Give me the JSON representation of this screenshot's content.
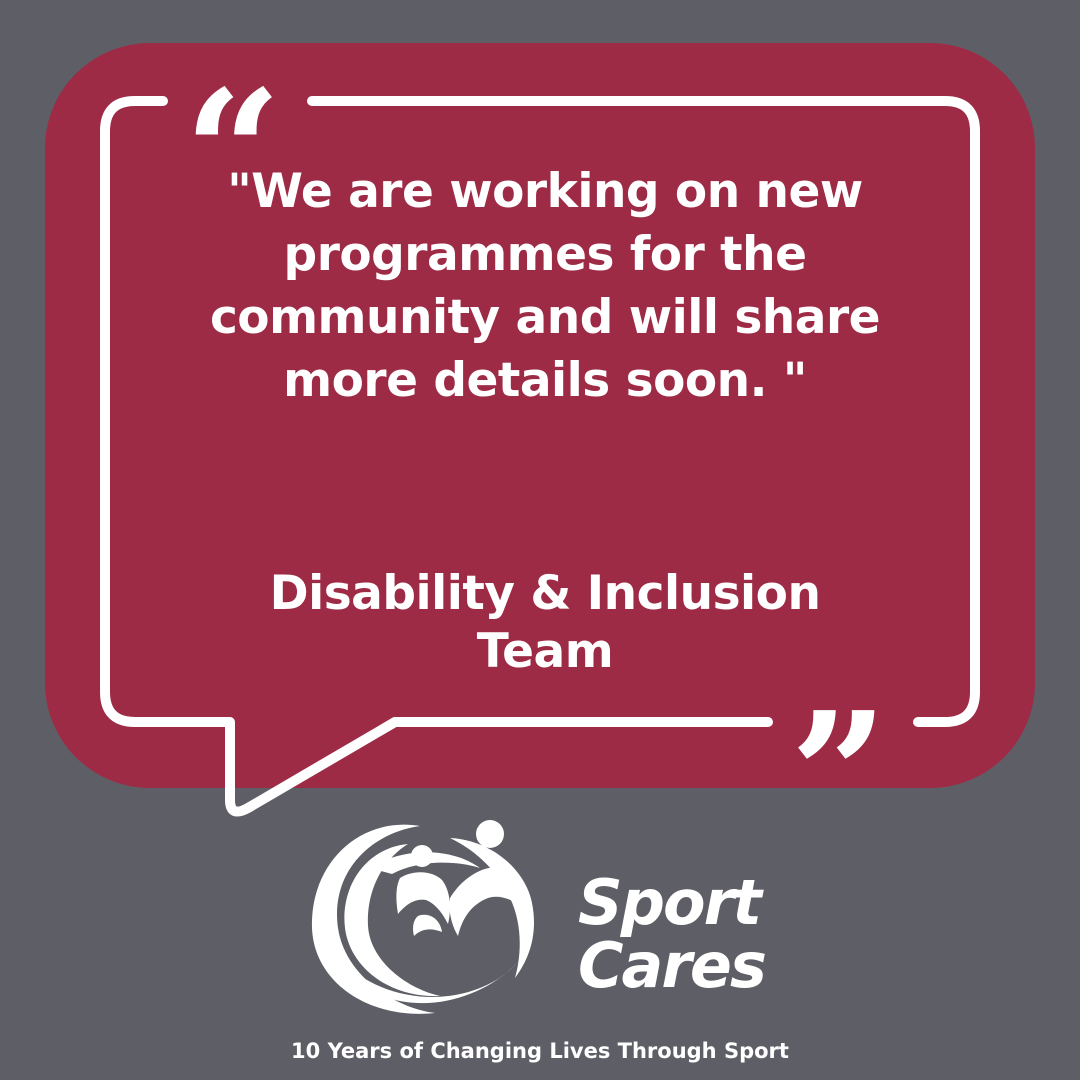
{
  "colors": {
    "background": "#5e5f66",
    "card": "#9e2b46",
    "text": "#ffffff"
  },
  "quote": {
    "open_mark": "“",
    "close_mark": "”",
    "lines": [
      "\"We are working on new",
      "programmes for the",
      "community and will share",
      "more details soon. \""
    ],
    "attribution_lines": [
      "Disability & Inclusion",
      "Team"
    ]
  },
  "logo": {
    "icon": "sport-cares-figures-logo-icon",
    "brand_line1": "Sport",
    "brand_line2": "Cares"
  },
  "tagline": "10 Years of Changing Lives Through Sport"
}
